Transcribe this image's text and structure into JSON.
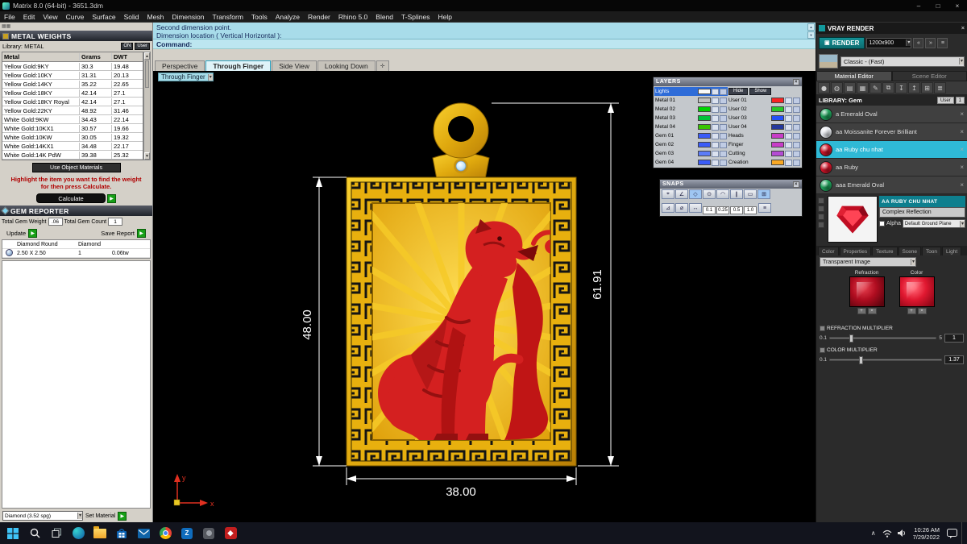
{
  "window": {
    "title": "Matrix 8.0 (64-bit) - 3651.3dm"
  },
  "menu": {
    "items": [
      "File",
      "Edit",
      "View",
      "Curve",
      "Surface",
      "Solid",
      "Mesh",
      "Dimension",
      "Transform",
      "Tools",
      "Analyze",
      "Render",
      "Rhino 5.0",
      "Blend",
      "T-Splines",
      "Help"
    ]
  },
  "metal_weights": {
    "title": "METAL WEIGHTS",
    "library_label": "Library: METAL",
    "buttons": {
      "on": "ON",
      "user": "User"
    },
    "columns": {
      "metal": "Metal",
      "grams": "Grams",
      "dwt": "DWT"
    },
    "rows": [
      {
        "metal": "Yellow Gold:9KY",
        "grams": "30.3",
        "dwt": "19.48"
      },
      {
        "metal": "Yellow Gold:10KY",
        "grams": "31.31",
        "dwt": "20.13"
      },
      {
        "metal": "Yellow Gold:14KY",
        "grams": "35.22",
        "dwt": "22.65"
      },
      {
        "metal": "Yellow Gold:18KY",
        "grams": "42.14",
        "dwt": "27.1"
      },
      {
        "metal": "Yellow Gold:18KY Royal",
        "grams": "42.14",
        "dwt": "27.1"
      },
      {
        "metal": "Yellow Gold:22KY",
        "grams": "48.92",
        "dwt": "31.46"
      },
      {
        "metal": "White Gold:9KW",
        "grams": "34.43",
        "dwt": "22.14"
      },
      {
        "metal": "White Gold:10KX1",
        "grams": "30.57",
        "dwt": "19.66"
      },
      {
        "metal": "White Gold:10KW",
        "grams": "30.05",
        "dwt": "19.32"
      },
      {
        "metal": "White Gold:14KX1",
        "grams": "34.48",
        "dwt": "22.17"
      },
      {
        "metal": "White Gold:14K PdW",
        "grams": "39.38",
        "dwt": "25.32"
      }
    ],
    "use_object_materials": "Use Object Materials",
    "instruction": "Highlight the item you want to find the weight for then press Calculate.",
    "calculate": "Calculate"
  },
  "gem_reporter": {
    "title": "GEM REPORTER",
    "total_weight_label": "Total Gem Weight",
    "total_weight_value": ".06",
    "total_count_label": "Total Gem Count",
    "total_count_value": "1",
    "update": "Update",
    "save_report": "Save Report",
    "gem_type": "Diamond Round",
    "gem_material": "Diamond",
    "gem_size": "2.50 X 2.50",
    "gem_count": "1",
    "gem_weight": "0.06tw"
  },
  "material_bar": {
    "selection": "Diamond (3.52 spg)",
    "set_material": "Set Material"
  },
  "command": {
    "line1": "Second dimension point.",
    "line2": "Dimension location ( Vertical  Horizontal ):",
    "prompt": "Command:"
  },
  "viewport": {
    "tabs": [
      "Perspective",
      "Through Finger",
      "Side View",
      "Looking Down"
    ],
    "active_tab": "Through Finger",
    "view_label": "Through Finger",
    "dim_left": "48.00",
    "dim_right": "61.91",
    "dim_bottom": "38.00"
  },
  "layers": {
    "title": "LAYERS",
    "hide": "Hide",
    "show": "Show",
    "left": [
      {
        "name": "Lights",
        "color": "#f8f8f8",
        "selected": true
      },
      {
        "name": "Metal 01",
        "color": "#c0c0c0"
      },
      {
        "name": "Metal 02",
        "color": "#00d400"
      },
      {
        "name": "Metal 03",
        "color": "#00c43a"
      },
      {
        "name": "Metal 04",
        "color": "#38c400"
      },
      {
        "name": "Gem 01",
        "color": "#3a5cf8"
      },
      {
        "name": "Gem 02",
        "color": "#3a5cf8"
      },
      {
        "name": "Gem 03",
        "color": "#5c7cf8"
      },
      {
        "name": "Gem 04",
        "color": "#3a5cf8"
      }
    ],
    "right": [
      {
        "name": "User 01",
        "color": "#f82424"
      },
      {
        "name": "User 02",
        "color": "#28c828"
      },
      {
        "name": "User 03",
        "color": "#2450f8"
      },
      {
        "name": "User 04",
        "color": "#24389c"
      },
      {
        "name": "Heads",
        "color": "#c83cc8"
      },
      {
        "name": "Finger",
        "color": "#c83cc8"
      },
      {
        "name": "Cutting",
        "color": "#b44cd4"
      },
      {
        "name": "Creation",
        "color": "#f8a824"
      }
    ]
  },
  "snaps": {
    "title": "SNAPS",
    "values": [
      "0.1",
      "0.25",
      "0.5",
      "1.0"
    ]
  },
  "vray": {
    "title": "VRAY RENDER",
    "render": "RENDER",
    "resolution": "1200x900",
    "style_value": "Classic - (Fast)",
    "tab_material": "Material Editor",
    "tab_scene": "Scene Editor",
    "library_label": "LIBRARY: Gem",
    "user_button": "User",
    "user_count": "1",
    "materials": [
      {
        "name": "a Emerald Oval",
        "color": "#1fa05a"
      },
      {
        "name": "aa Moissanite Forever Brilliant",
        "color": "#e6e9ee"
      },
      {
        "name": "aa Ruby chu nhat",
        "color": "#d01428",
        "selected": true
      },
      {
        "name": "aa Ruby",
        "color": "#d01428"
      },
      {
        "name": "aaa Emerald Oval",
        "color": "#1fa05a"
      }
    ],
    "selected": {
      "title": "AA RUBY CHU NHAT",
      "reflection": "Complex Reflection",
      "alpha": "Alpha",
      "ground_plane": "Default Ground Plane"
    },
    "color_tabs": [
      "Color",
      "Properties",
      "Texture",
      "Scene",
      "Toon",
      "Light"
    ],
    "map_type": "Transparent Image",
    "swatch_refraction": "Refraction",
    "swatch_color": "Color",
    "refraction_multiplier": {
      "label": "REFRACTION MULTIPLIER",
      "min": "0.1",
      "max": "5",
      "value": "1"
    },
    "color_multiplier": {
      "label": "COLOR MULTIPLIER",
      "min": "0.1",
      "value": "1.37"
    }
  },
  "taskbar": {
    "time": "10:26 AM",
    "date": "7/29/2022"
  }
}
